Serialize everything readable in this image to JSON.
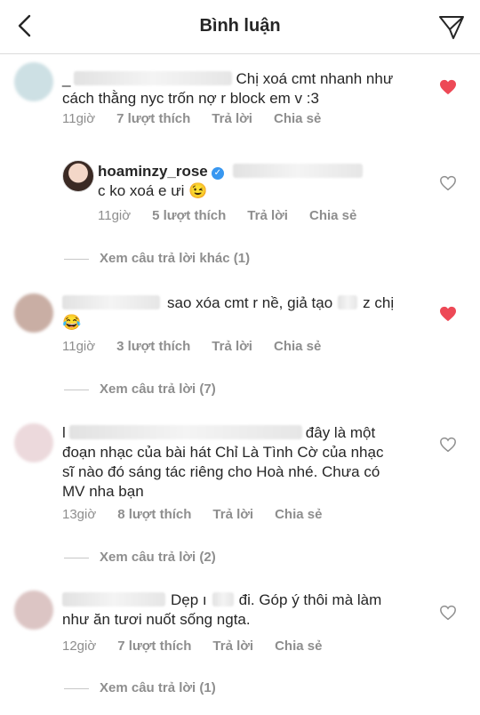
{
  "header": {
    "title": "Bình luận"
  },
  "comments": [
    {
      "text": "_ Chị xoá cmt nhanh như cách thằng nyc trốn nợ r block em v :3",
      "line1_prefix": "_",
      "line1": "_ Chị xoá cmt nhanh như",
      "line2": "cách thằng nyc trốn nợ r block em v :3",
      "time": "11giờ",
      "likes": "7 lượt thích",
      "reply": "Trả lời",
      "share": "Chia sẻ",
      "liked": true
    },
    {
      "username": "hoaminzy_rose",
      "text": "c ko xoá e ưi 😉",
      "time": "11giờ",
      "likes": "5 lượt thích",
      "reply": "Trả lời",
      "share": "Chia sẻ",
      "liked": false,
      "more_replies": "Xem câu trả lời khác (1)"
    },
    {
      "line1": "sao xóa cmt r nề, giả tạo",
      "line1_end": "z chị",
      "line2": "😂",
      "time": "11giờ",
      "likes": "3 lượt thích",
      "reply": "Trả lời",
      "share": "Chia sẻ",
      "liked": true,
      "more_replies": "Xem câu trả lời (7)"
    },
    {
      "line1_prefix": "l",
      "line1": "đây là một",
      "line2": "đoạn nhạc của bài hát Chỉ Là Tình Cờ của nhạc",
      "line3": "sĩ nào đó sáng tác riêng cho Hoà nhé. Chưa có",
      "line4": "MV nha bạn",
      "time": "13giờ",
      "likes": "8 lượt thích",
      "reply": "Trả lời",
      "share": "Chia sẻ",
      "liked": false,
      "more_replies": "Xem câu trả lời (2)"
    },
    {
      "line1": "Dẹp",
      "line1_mid": "ı",
      "line1_end": "đi. Góp ý thôi mà làm",
      "line2": "như ăn tươi nuốt sống ngta.",
      "time": "12giờ",
      "likes": "7 lượt thích",
      "reply": "Trả lời",
      "share": "Chia sẻ",
      "liked": false,
      "more_replies": "Xem câu trả lời (1)"
    }
  ],
  "colors": {
    "heart_liked": "#ed4956",
    "heart_outline": "#8e8e8e",
    "meta": "#8e8e8e",
    "verified": "#3897f0"
  },
  "icons": [
    "back-chevron-icon",
    "send-icon",
    "heart-filled-icon",
    "heart-outline-icon",
    "verified-badge-icon"
  ]
}
